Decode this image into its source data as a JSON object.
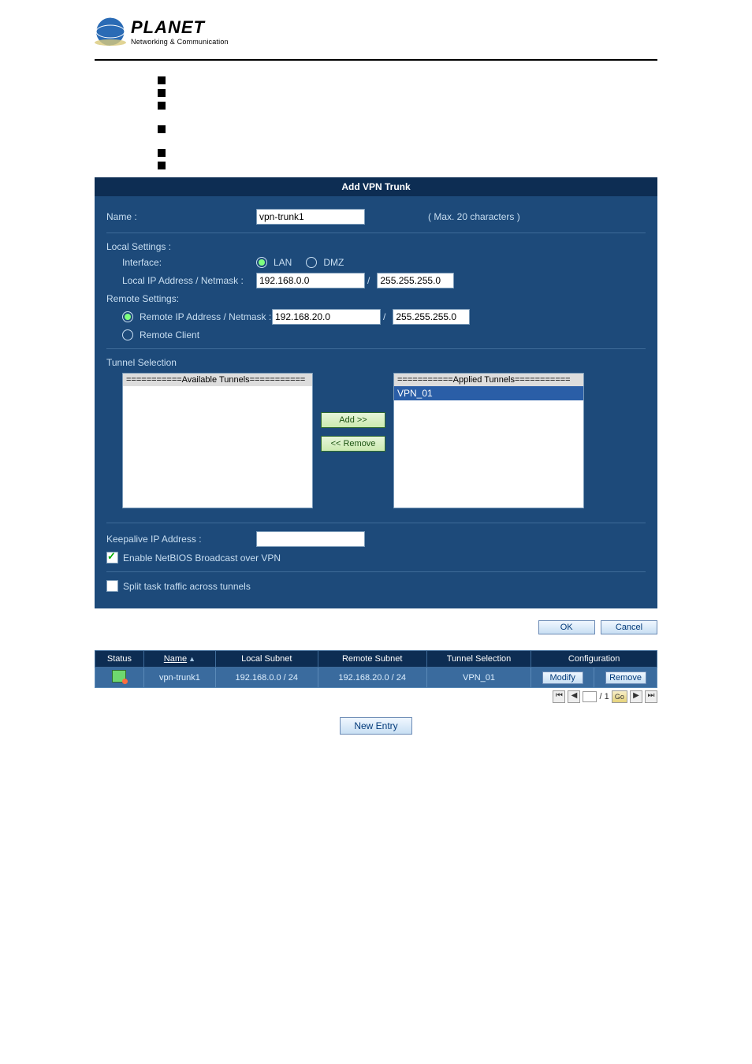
{
  "logo": {
    "brand": "PLANET",
    "tagline": "Networking & Communication"
  },
  "panel_title": "Add VPN Trunk",
  "form": {
    "name_label": "Name :",
    "name_value": "vpn-trunk1",
    "max_text": "( Max. 20 characters )",
    "local_settings_label": "Local Settings :",
    "interface_label": "Interface:",
    "interface_options": {
      "lan": "LAN",
      "dmz": "DMZ"
    },
    "local_ip_label": "Local IP Address / Netmask :",
    "local_ip_value": "192.168.0.0",
    "local_mask_value": "255.255.255.0",
    "remote_settings_label": "Remote Settings:",
    "remote_ip_radio_label": "Remote IP Address / Netmask :",
    "remote_ip_value": "192.168.20.0",
    "remote_mask_value": "255.255.255.0",
    "remote_client_label": "Remote Client",
    "tunnel_selection_label": "Tunnel Selection",
    "available_header": "===========Available Tunnels===========",
    "applied_header": "===========Applied Tunnels===========",
    "applied_item": "VPN_01",
    "add_btn": "Add >>",
    "remove_btn": "<< Remove",
    "keepalive_label": "Keepalive IP Address :",
    "keepalive_value": "",
    "netbios_label": "Enable NetBIOS Broadcast over VPN",
    "split_label": "Split task traffic across tunnels"
  },
  "bottom_buttons": {
    "ok": "OK",
    "cancel": "Cancel"
  },
  "table": {
    "headers": {
      "status": "Status",
      "name": "Name",
      "local_subnet": "Local Subnet",
      "remote_subnet": "Remote Subnet",
      "tunnel_selection": "Tunnel Selection",
      "configuration": "Configuration"
    },
    "row": {
      "name": "vpn-trunk1",
      "local_subnet": "192.168.0.0 / 24",
      "remote_subnet": "192.168.20.0 / 24",
      "tunnel_selection": "VPN_01",
      "modify": "Modify",
      "remove": "Remove"
    }
  },
  "pager": {
    "page_value": "",
    "total_pages": "1",
    "go": "Go"
  },
  "new_entry": "New Entry"
}
